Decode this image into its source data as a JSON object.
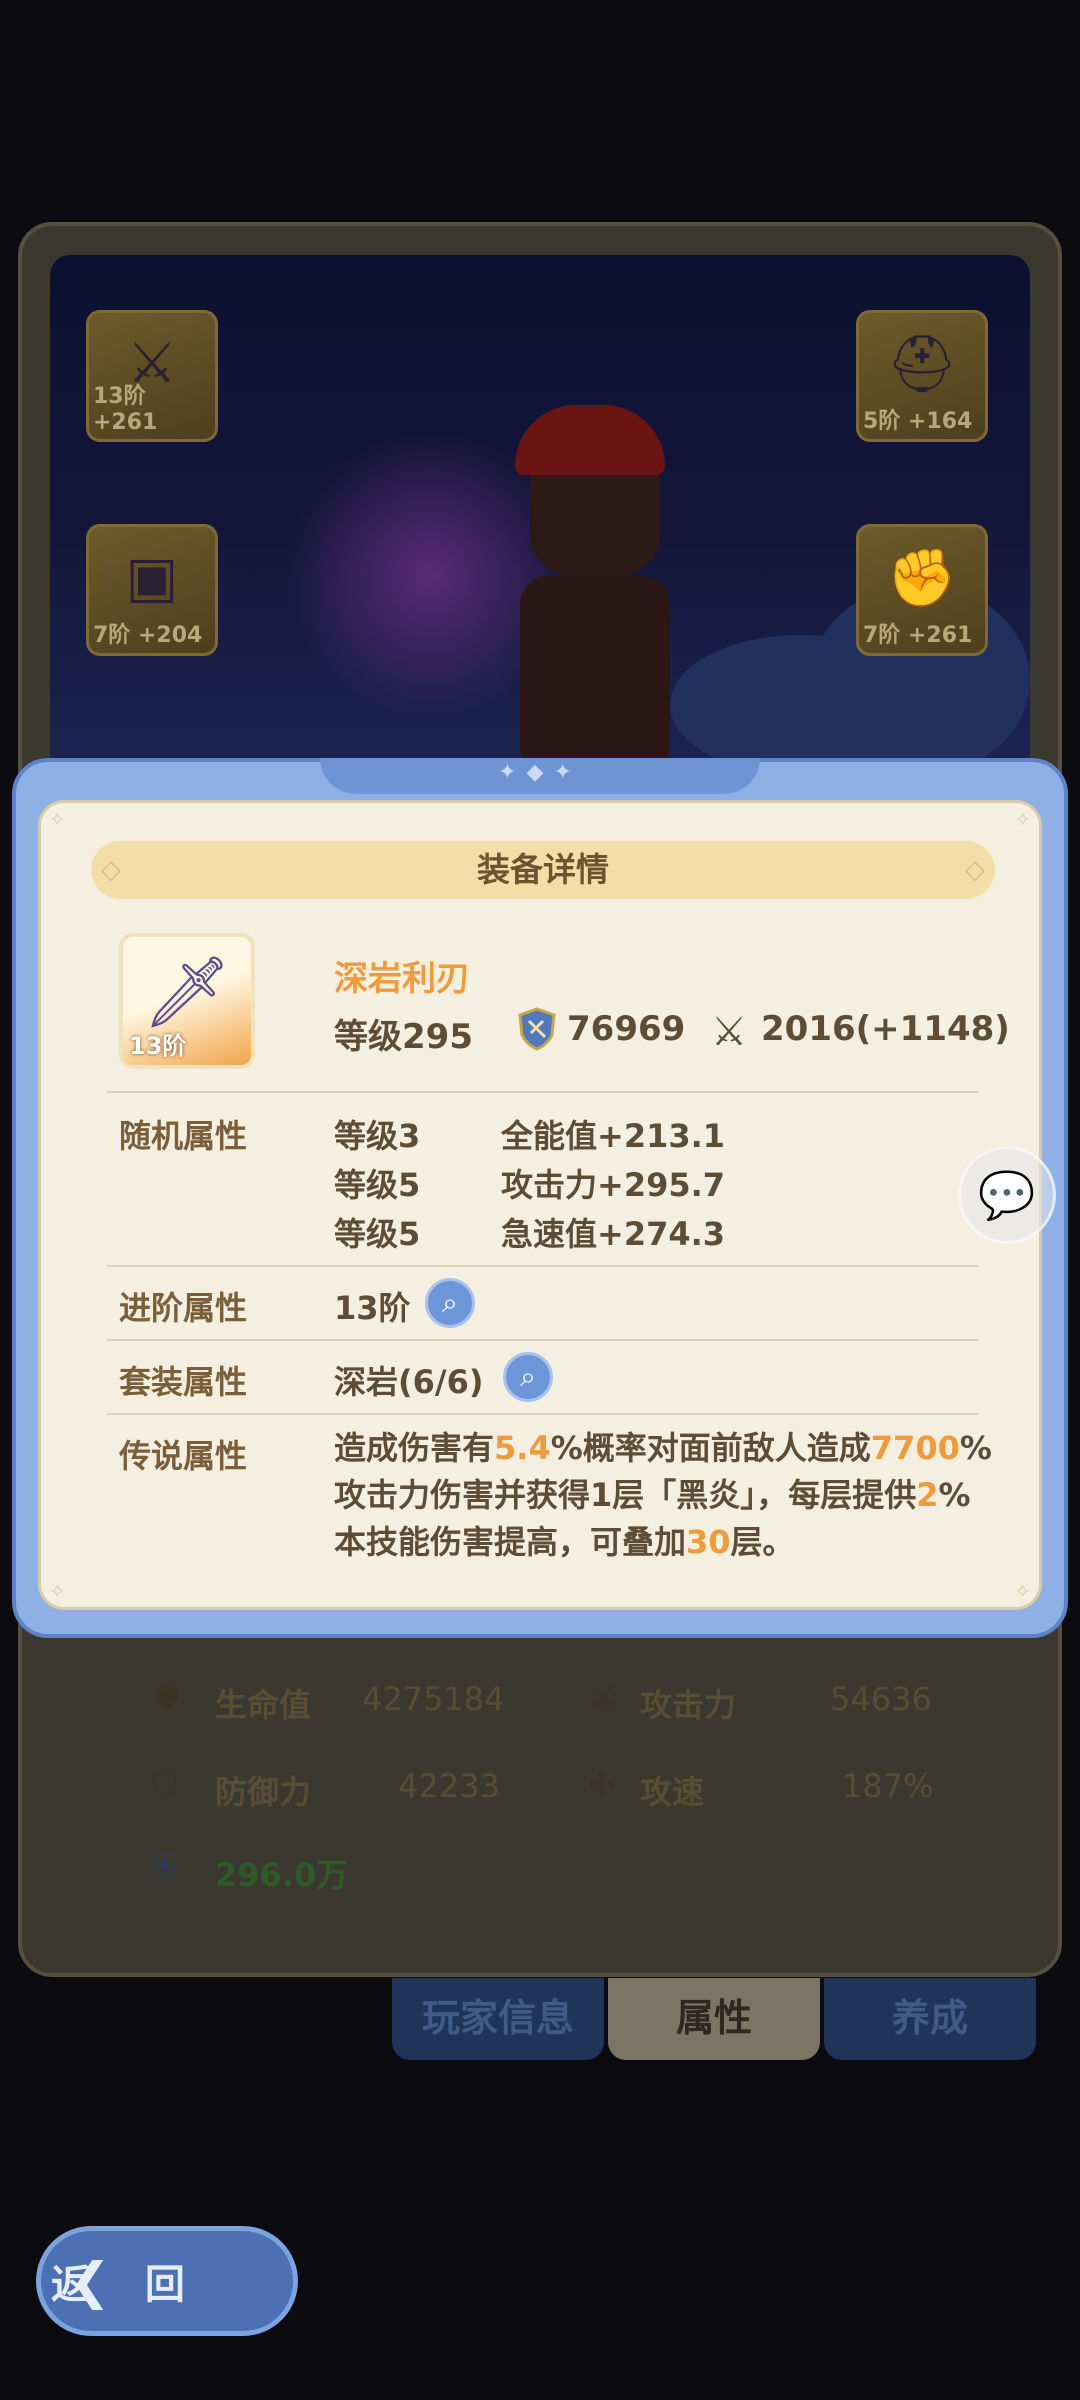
{
  "equipment_slots": [
    {
      "label": "13阶 +261",
      "icon": "sword-icon"
    },
    {
      "label": "5阶 +164",
      "icon": "helmet-icon"
    },
    {
      "label": "7阶 +204",
      "icon": "armor-icon"
    },
    {
      "label": "7阶 +261",
      "icon": "gauntlet-icon"
    }
  ],
  "modal": {
    "title": "装备详情",
    "item": {
      "name": "深岩利刃",
      "icon_tier": "13阶",
      "level": "等级295",
      "power": "76969",
      "attack": "2016(+1148)"
    },
    "random_attrs": {
      "label": "随机属性",
      "rows": [
        {
          "level": "等级3",
          "stat": "全能值+213.1"
        },
        {
          "level": "等级5",
          "stat": "攻击力+295.7"
        },
        {
          "level": "等级5",
          "stat": "急速值+274.3"
        }
      ]
    },
    "advance_attrs": {
      "label": "进阶属性",
      "value": "13阶"
    },
    "set_attrs": {
      "label": "套装属性",
      "value": "深岩(6/6)"
    },
    "legend_attrs": {
      "label": "传说属性",
      "parts": [
        "造成伤害有",
        "5.4",
        "%概率对面前敌人造成",
        "7700",
        "%攻击力伤害并获得1层「黑炎」，每层提供",
        "2",
        "%本技能伤害提高，可叠加",
        "30",
        "层。"
      ]
    }
  },
  "stats": {
    "hp_label": "生命值",
    "hp_value": "4275184",
    "atk_label": "攻击力",
    "atk_value": "54636",
    "def_label": "防御力",
    "def_value": "42233",
    "spd_label": "攻速",
    "spd_value": "187%",
    "power_total": "296.0万"
  },
  "tabs": {
    "player_info": "玩家信息",
    "attributes": "属性",
    "develop": "养成"
  },
  "back": {
    "label": "返 回"
  },
  "colors": {
    "accent_orange": "#f09a3a",
    "modal_blue": "#8fb0e4",
    "panel_cream": "#f4efe1"
  }
}
